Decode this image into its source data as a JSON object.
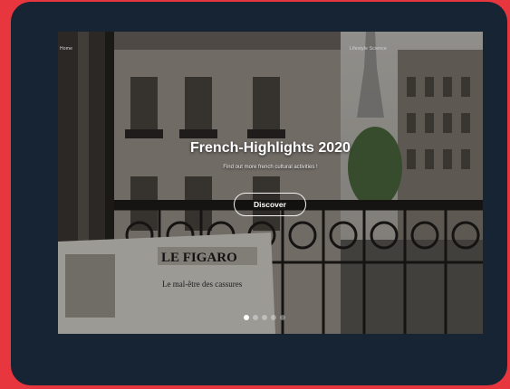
{
  "hero": {
    "nav_left": "Home",
    "nav_right": "Lifestyle    Science",
    "title": "French-Highlights 2020",
    "subtitle": "Find out more french cultural activities !",
    "cta_label": "Discover",
    "newspaper_masthead": "LE FIGARO",
    "newspaper_headline": "Le mal-être des cassures",
    "slides_total": 5,
    "slide_active": 1
  },
  "colors": {
    "background": "#e8363f",
    "frame": "#162433",
    "button_border": "#f3f3f3"
  }
}
